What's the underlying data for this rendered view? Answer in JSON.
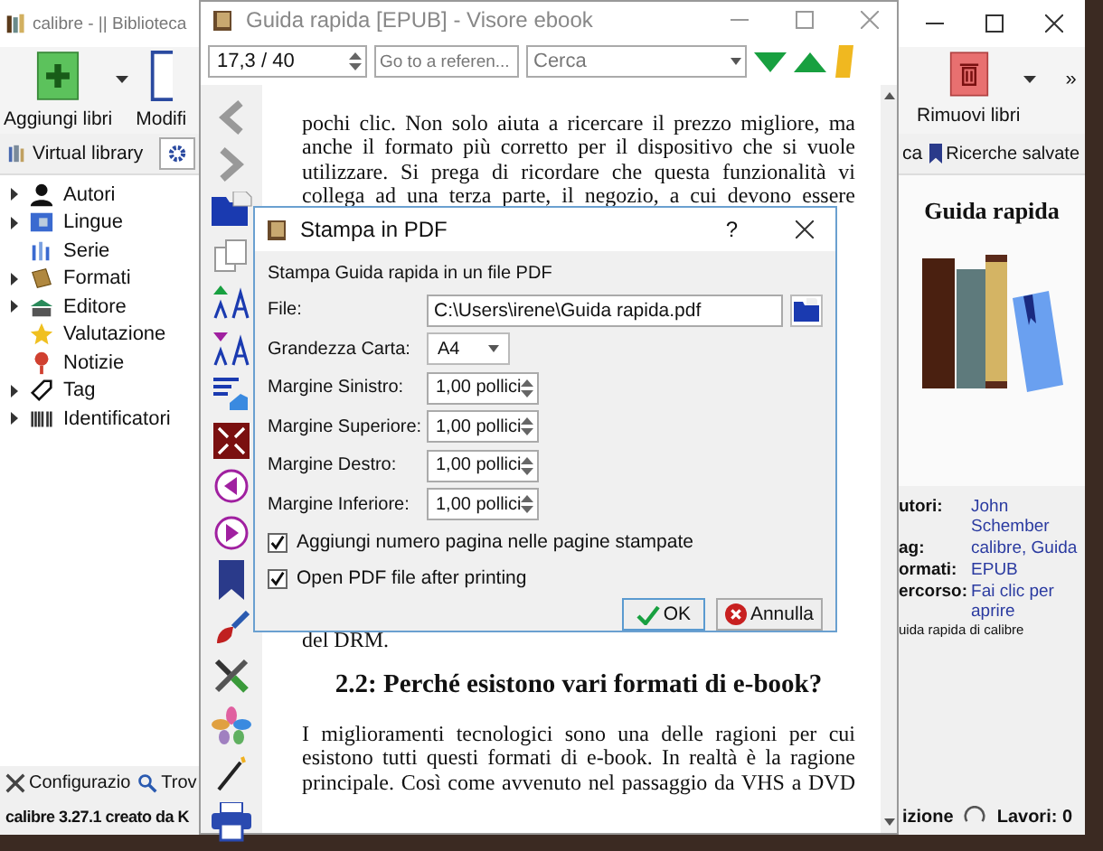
{
  "main_window": {
    "title": "calibre - || Biblioteca",
    "toolbar_left": [
      {
        "label": "Aggiungi libri",
        "kind": "add"
      },
      {
        "label": "Modifi",
        "kind": "edit"
      }
    ],
    "toolbar_right": {
      "label": "Rimuovi libri",
      "overflow": "»"
    },
    "virtual_library": "Virtual library",
    "search_tail": "ca",
    "saved_searches": "Ricerche salvate",
    "tree": [
      {
        "label": "Autori",
        "kind": "person",
        "expandable": true
      },
      {
        "label": "Lingue",
        "kind": "language",
        "expandable": true
      },
      {
        "label": "Serie",
        "kind": "series",
        "expandable": false
      },
      {
        "label": "Formati",
        "kind": "format",
        "expandable": true
      },
      {
        "label": "Editore",
        "kind": "publisher",
        "expandable": true
      },
      {
        "label": "Valutazione",
        "kind": "rating",
        "expandable": false
      },
      {
        "label": "Notizie",
        "kind": "news",
        "expandable": false
      },
      {
        "label": "Tag",
        "kind": "tag",
        "expandable": true
      },
      {
        "label": "Identificatori",
        "kind": "identifier",
        "expandable": true
      }
    ],
    "book_title": "Guida rapida",
    "details": [
      {
        "label": "utori:",
        "value": "John Schember"
      },
      {
        "label": "ag:",
        "value": "calibre, Guida"
      },
      {
        "label": "ormati:",
        "value": "EPUB"
      },
      {
        "label": "ercorso:",
        "value": "Fai clic per aprire"
      }
    ],
    "comment": "uida rapida di calibre",
    "bottom_buttons": [
      {
        "label": "Configurazio",
        "kind": "tools"
      },
      {
        "label": "Trov",
        "kind": "search"
      }
    ],
    "status": "calibre 3.27.1 creato da K",
    "status_tail": "izione",
    "jobs": "Lavori: 0"
  },
  "viewer": {
    "title": "Guida rapida [EPUB] - Visore ebook",
    "position": "17,3 / 40",
    "reference_placeholder": "Go to a referen...",
    "search_placeholder": "Cerca",
    "lines_before": [
      "pochi clic. Non solo aiuta a ricercare il prezzo migliore, ma",
      "anche il formato più corretto per il dispositivo che si vuole",
      "utilizzare. Si prega di ricordare che questa funzionalità vi",
      "collega ad una terza parte, il negozio, a cui devono essere"
    ],
    "fragment": "del DRM.",
    "heading": "2.2: Perché esistono vari formati di e-book?",
    "lines_after": [
      "I miglioramenti tecnologici sono una delle ragioni per cui",
      "esistono tutti questi formati di e-book. In realtà è la ragione",
      "principale. Così come avvenuto nel passaggio da VHS a DVD"
    ]
  },
  "dialog": {
    "title": "Stampa in PDF",
    "help": "?",
    "heading": "Stampa Guida rapida in un file PDF",
    "file_label": "File:",
    "file_value": "C:\\Users\\irene\\Guida rapida.pdf",
    "paper_label": "Grandezza Carta:",
    "paper_value": "A4",
    "margins": [
      {
        "label": "Margine Sinistro:",
        "value": "1,00 pollici"
      },
      {
        "label": "Margine Superiore:",
        "value": "1,00 pollici"
      },
      {
        "label": "Margine Destro:",
        "value": "1,00 pollici"
      },
      {
        "label": "Margine Inferiore:",
        "value": "1,00 pollici"
      }
    ],
    "options": [
      {
        "label": "Aggiungi numero pagina nelle pagine stampate",
        "checked": true
      },
      {
        "label": "Open PDF file after printing",
        "checked": true
      }
    ],
    "buttons": [
      {
        "label": "OK",
        "kind": "ok"
      },
      {
        "label": "Annulla",
        "kind": "cancel"
      }
    ]
  }
}
